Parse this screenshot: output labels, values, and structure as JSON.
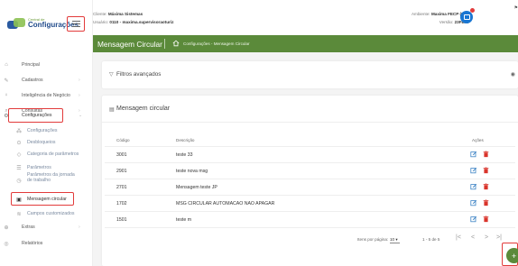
{
  "brand": {
    "small": "Central de",
    "big": "Configurações"
  },
  "header": {
    "client_label": "Cliente: ",
    "client_value": "Máxima Sistemas",
    "user_label": "Usuário: ",
    "user_value": "0110 - maxima.supervisoraoturiz",
    "env_label": "Ambiente: ",
    "env_value": "Maxima FECP (Dev)",
    "version_label": "Versão: ",
    "version_value": "23FECP"
  },
  "titlebar": {
    "title": "Mensagem Circular",
    "breadcrumb": "Configurações - Mensagem Circular"
  },
  "sidebar": {
    "items": [
      {
        "label": "Principal",
        "icon": "home-icon"
      },
      {
        "label": "Cadastros",
        "icon": "edit-icon"
      },
      {
        "label": "Inteligência de Negócio",
        "icon": "bulb-icon"
      },
      {
        "label": "Consultas",
        "icon": "search-icon"
      },
      {
        "label": "Configurações",
        "icon": "gear-icon"
      }
    ],
    "subitems": [
      {
        "label": "Configurações",
        "icon": "people-icon"
      },
      {
        "label": "Desbloqueios",
        "icon": "lock-icon"
      },
      {
        "label": "Categoria de parâmetros",
        "icon": "tag-icon"
      },
      {
        "label": "Parâmetros",
        "icon": "list-icon"
      },
      {
        "label": "Parâmetros da jornada",
        "label2": "de trabalho",
        "icon": "clock-icon"
      },
      {
        "label": "Mensagem circular",
        "icon": "message-icon"
      },
      {
        "label": "Campos customizados",
        "icon": "fields-icon"
      }
    ],
    "bottom": [
      {
        "label": "Extras",
        "icon": "plus-circle-icon"
      },
      {
        "label": "Relatórios",
        "icon": "report-icon"
      }
    ]
  },
  "filters": {
    "label": "Filtros avançados"
  },
  "panel": {
    "title": "Mensagem circular",
    "columns": {
      "code": "Código",
      "description": "Descrição",
      "actions": "Ações"
    },
    "rows": [
      {
        "code": "3001",
        "description": "teste 33"
      },
      {
        "code": "2901",
        "description": "teste nova msg"
      },
      {
        "code": "2701",
        "description": "Mensagem teste JP"
      },
      {
        "code": "1702",
        "description": "MSG CIRCULAR AUTOMACAO NAO APAGAR"
      },
      {
        "code": "1501",
        "description": "teste m"
      }
    ]
  },
  "pagination": {
    "items_per_page_label": "Itens por página:",
    "items_per_page_value": "10",
    "range": "1 - 5 de 5",
    "first": "|<",
    "prev": "<",
    "next": ">",
    "last": ">|"
  },
  "fab": {
    "label": "+"
  },
  "colors": {
    "accent": "#5b8a3a",
    "highlight": "#e23b3b",
    "avatar": "#1976d2"
  }
}
